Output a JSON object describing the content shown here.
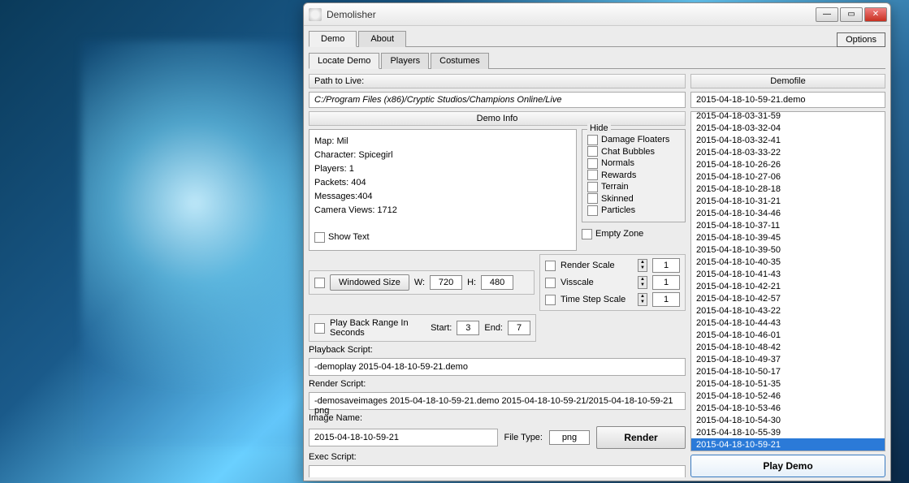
{
  "window": {
    "title": "Demolisher"
  },
  "toolbar": {
    "tabs": {
      "demo": "Demo",
      "about": "About"
    },
    "options": "Options"
  },
  "subtabs": {
    "locate": "Locate Demo",
    "players": "Players",
    "costumes": "Costumes"
  },
  "path": {
    "label": "Path to Live:",
    "value": "C:/Program Files (x86)/Cryptic Studios/Champions Online/Live"
  },
  "demoinfo": {
    "header": "Demo Info",
    "map": "Map: Mil",
    "character": "Character: Spicegirl",
    "players": "Players: 1",
    "packets": "Packets: 404",
    "messages": "Messages:404",
    "cameraviews": "Camera Views: 1712",
    "showtext": "Show Text"
  },
  "hide": {
    "legend": "Hide",
    "damage_floaters": "Damage Floaters",
    "chat_bubbles": "Chat Bubbles",
    "normals": "Normals",
    "rewards": "Rewards",
    "terrain": "Terrain",
    "skinned": "Skinned",
    "particles": "Particles",
    "empty_zone": "Empty Zone"
  },
  "size": {
    "windowed": "Windowed Size",
    "w_label": "W:",
    "w": "720",
    "h_label": "H:",
    "h": "480"
  },
  "scales": {
    "render_scale": "Render Scale",
    "render_val": "1",
    "visscale": "Visscale",
    "vis_val": "1",
    "timestep": "Time Step Scale",
    "time_val": "1"
  },
  "playback": {
    "range_label": "Play Back Range In Seconds",
    "start_label": "Start:",
    "start": "3",
    "end_label": "End:",
    "end": "7"
  },
  "scripts": {
    "playback_label": "Playback Script:",
    "playback_value": "-demoplay 2015-04-18-10-59-21.demo",
    "render_label": "Render Script:",
    "render_value": "-demosaveimages  2015-04-18-10-59-21.demo 2015-04-18-10-59-21/2015-04-18-10-59-21 png",
    "image_name_label": "Image Name:",
    "image_name": "2015-04-18-10-59-21",
    "filetype_label": "File Type:",
    "filetype": "png",
    "render_btn": "Render",
    "exec_label": "Exec Script:",
    "exec_value": ""
  },
  "demofile": {
    "header": "Demofile",
    "current": "2015-04-18-10-59-21.demo",
    "items": [
      "2015-04-18-03-31-59",
      "2015-04-18-03-32-04",
      "2015-04-18-03-32-41",
      "2015-04-18-03-33-22",
      "2015-04-18-10-26-26",
      "2015-04-18-10-27-06",
      "2015-04-18-10-28-18",
      "2015-04-18-10-31-21",
      "2015-04-18-10-34-46",
      "2015-04-18-10-37-11",
      "2015-04-18-10-39-45",
      "2015-04-18-10-39-50",
      "2015-04-18-10-40-35",
      "2015-04-18-10-41-43",
      "2015-04-18-10-42-21",
      "2015-04-18-10-42-57",
      "2015-04-18-10-43-22",
      "2015-04-18-10-44-43",
      "2015-04-18-10-46-01",
      "2015-04-18-10-48-42",
      "2015-04-18-10-49-37",
      "2015-04-18-10-50-17",
      "2015-04-18-10-51-35",
      "2015-04-18-10-52-46",
      "2015-04-18-10-53-46",
      "2015-04-18-10-54-30",
      "2015-04-18-10-55-39",
      "2015-04-18-10-59-21"
    ],
    "selected_index": 27
  },
  "play_demo": "Play Demo"
}
